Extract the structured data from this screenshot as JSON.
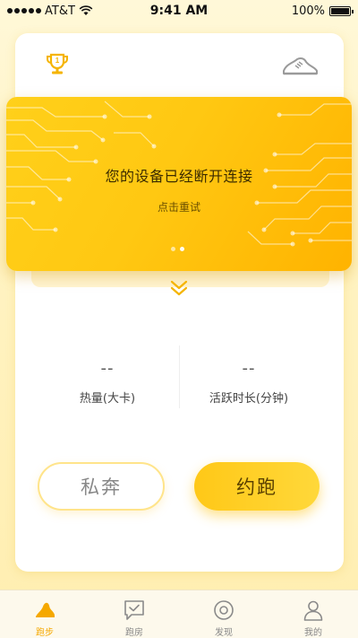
{
  "status_bar": {
    "carrier": "AT&T",
    "time": "9:41 AM",
    "battery": "100%",
    "battery_level": 1.0
  },
  "header": {
    "trophy_badge": "1",
    "trophy_icon": "trophy-icon",
    "shoe_icon": "running-shoe-icon"
  },
  "banner": {
    "title": "您的设备已经断开连接",
    "subtitle": "点击重试",
    "page_count": 2,
    "active_page": 2
  },
  "stats": {
    "calories": {
      "value": "--",
      "label": "热量(大卡)"
    },
    "active_time": {
      "value": "--",
      "label": "活跃时长(分钟)"
    }
  },
  "actions": {
    "solo_label": "私奔",
    "meet_label": "约跑"
  },
  "tabs": [
    {
      "label": "跑步",
      "icon": "shoe-tab-icon",
      "active": true
    },
    {
      "label": "跑房",
      "icon": "chat-check-icon",
      "active": false
    },
    {
      "label": "发现",
      "icon": "discover-icon",
      "active": false
    },
    {
      "label": "我的",
      "icon": "profile-icon",
      "active": false
    }
  ],
  "colors": {
    "accent": "#ffc817",
    "accent_dark": "#f5a800",
    "background": "#fff6d0"
  }
}
